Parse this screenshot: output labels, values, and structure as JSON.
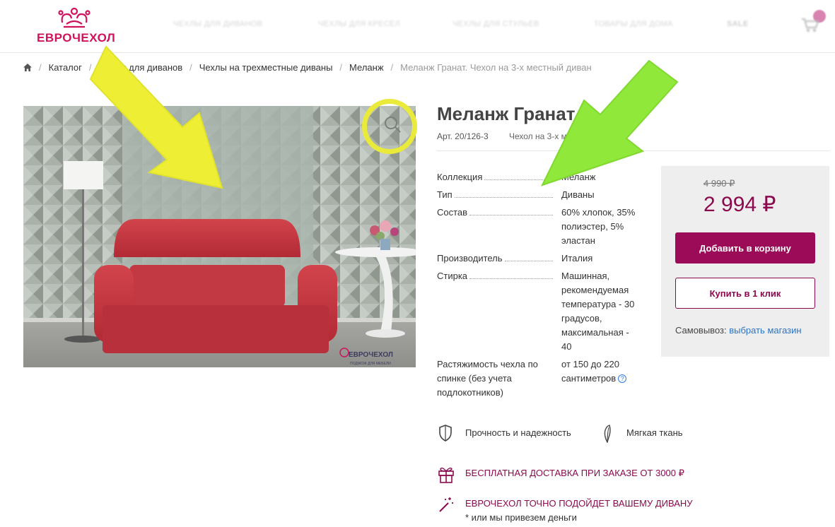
{
  "header": {
    "logo_text": "ЕВРОЧЕХОЛ",
    "nav": [
      "ЧЕХЛЫ ДЛЯ ДИВАНОВ",
      "ЧЕХЛЫ ДЛЯ КРЕСЕЛ",
      "ЧЕХЛЫ ДЛЯ СТУЛЬЕВ",
      "ТОВАРЫ ДЛЯ ДОМА",
      "SALE"
    ],
    "cart_icon": "cart-icon"
  },
  "breadcrumb": {
    "home_icon": "home-icon",
    "items": [
      "Каталог",
      "Чехлы для диванов",
      "Чехлы на трехместные диваны",
      "Меланж"
    ],
    "current": "Меланж Гранат. Чехол на 3-х местный диван"
  },
  "product": {
    "title": "Меланж Гранат",
    "sku": "Арт. 20/126-3",
    "subtitle": "Чехол на 3-х местный диван",
    "image_watermark": "ЕВРОЧЕХОЛ",
    "image_watermark_tagline": "ПОДЖОЖ ДЛЯ МЕБЕЛИ"
  },
  "specs": [
    {
      "label": "Коллекция",
      "value": "Меланж"
    },
    {
      "label": "Тип",
      "value": "Диваны"
    },
    {
      "label": "Состав",
      "value": "60% хлопок, 35% полиэстер, 5% эластан"
    },
    {
      "label": "Производитель",
      "value": "Италия"
    },
    {
      "label": "Стирка",
      "value": "Машинная, рекомендуемая температура - 30 градусов, максимальная - 40"
    },
    {
      "label": "Растяжимость чехла по спинке (без учета подлокотников)",
      "value": "от 150 до 220 сантиметров",
      "help": "?"
    }
  ],
  "price": {
    "old": "4 990 ₽",
    "new": "2 994 ₽",
    "add_to_cart": "Добавить в корзину",
    "buy_one_click": "Купить в 1 клик",
    "pickup_label": "Самовывоз:",
    "pickup_link": "выбрать магазин"
  },
  "features": [
    {
      "icon": "shield-icon",
      "label": "Прочность и надежность"
    },
    {
      "icon": "feather-icon",
      "label": "Мягкая ткань"
    }
  ],
  "promos": {
    "delivery": "БЕСПЛАТНАЯ ДОСТАВКА ПРИ ЗАКАЗЕ ОТ 3000 ₽",
    "fit": "ЕВРОЧЕХОЛ ТОЧНО ПОДОЙДЕТ ВАШЕМУ ДИВАНУ",
    "fit_note": "* или мы привезем деньги",
    "delivery_icon": "gift-icon",
    "fit_icon": "magic-wand-icon"
  },
  "colors": {
    "brand": "#d0115c",
    "accent": "#9b0b57",
    "annotation_yellow": "#eeef34",
    "annotation_green": "#8fe83a"
  }
}
